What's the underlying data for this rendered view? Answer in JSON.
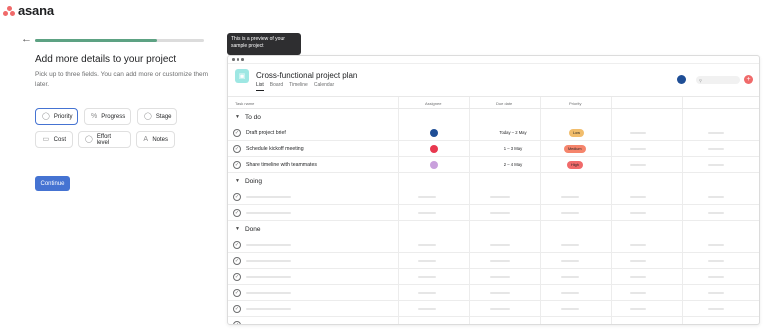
{
  "brand": {
    "name": "asana"
  },
  "onboarding": {
    "progress_fraction": 0.72,
    "heading": "Add more details to your project",
    "subtext": "Pick up to three fields. You can add more or customize them later.",
    "fields": [
      {
        "label": "Priority",
        "icon": "check-circle-icon",
        "selected": true
      },
      {
        "label": "Progress",
        "icon": "percent-icon",
        "selected": false
      },
      {
        "label": "Stage",
        "icon": "dropdown-circle-icon",
        "selected": false
      },
      {
        "label": "Cost",
        "icon": "money-icon",
        "selected": false
      },
      {
        "label": "Effort level",
        "icon": "number-circle-icon",
        "selected": false
      },
      {
        "label": "Notes",
        "icon": "text-icon",
        "selected": false
      }
    ],
    "continue_label": "Continue"
  },
  "tooltip": {
    "text": "This is a preview of your sample project"
  },
  "preview": {
    "title": "Cross-functional project plan",
    "tabs": [
      "List",
      "Board",
      "Timeline",
      "Calendar"
    ],
    "active_tab": "List",
    "columns": [
      "Task name",
      "Assignee",
      "Due date",
      "Priority"
    ],
    "sections": [
      {
        "name": "To do",
        "tasks": [
          {
            "name": "Draft project brief",
            "due": "Today – 2 May",
            "priority": "Low",
            "priority_color": "#f1bd6c",
            "avatar_color": "#1f4e96"
          },
          {
            "name": "Schedule kickoff meeting",
            "due": "1 – 3 May",
            "priority": "Medium",
            "priority_color": "#f5856c",
            "avatar_color": "#e8384f"
          },
          {
            "name": "Share timeline with teammates",
            "due": "2 – 4 May",
            "priority": "High",
            "priority_color": "#f06a6a",
            "avatar_color": "#c9a0dc"
          }
        ]
      },
      {
        "name": "Doing",
        "tasks": []
      },
      {
        "name": "Done",
        "tasks": []
      }
    ]
  },
  "colors": {
    "accent": "#4573d2",
    "progress": "#5da283",
    "brand": "#f06a6a"
  }
}
